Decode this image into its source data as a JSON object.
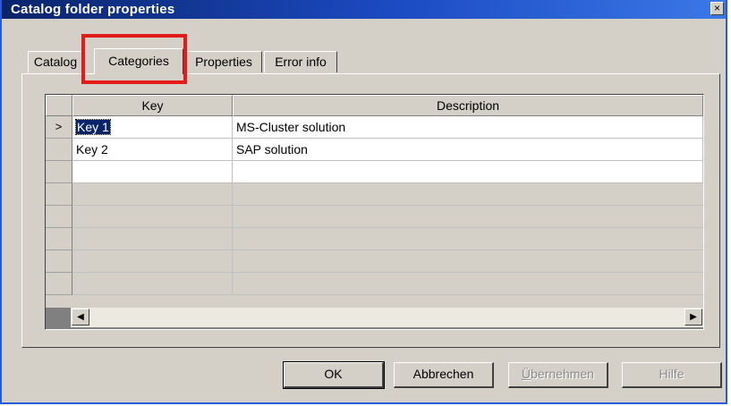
{
  "window": {
    "title": "Catalog folder properties",
    "close_glyph": "×"
  },
  "tabs": [
    {
      "label": "Catalog",
      "active": false
    },
    {
      "label": "Categories",
      "active": true
    },
    {
      "label": "Properties",
      "active": false
    },
    {
      "label": "Error info",
      "active": false
    }
  ],
  "grid": {
    "columns": [
      "Key",
      "Description"
    ],
    "current_row_marker": ">",
    "rows": [
      {
        "key": "Key 1",
        "description": "MS-Cluster solution",
        "selected": true
      },
      {
        "key": "Key 2",
        "description": "SAP solution",
        "selected": false
      }
    ]
  },
  "scrollbar": {
    "left_icon": "arrow-left-icon",
    "right_icon": "arrow-right-icon",
    "left_glyph": "◀",
    "right_glyph": "▶"
  },
  "buttons": {
    "ok": "OK",
    "cancel": "Abbrechen",
    "apply_first": "Ü",
    "apply_rest": "bernehmen",
    "help": "Hilfe"
  },
  "colors": {
    "highlight": "#e41b1b",
    "titlebar": "#0a246a",
    "selection": "#0a246a"
  }
}
